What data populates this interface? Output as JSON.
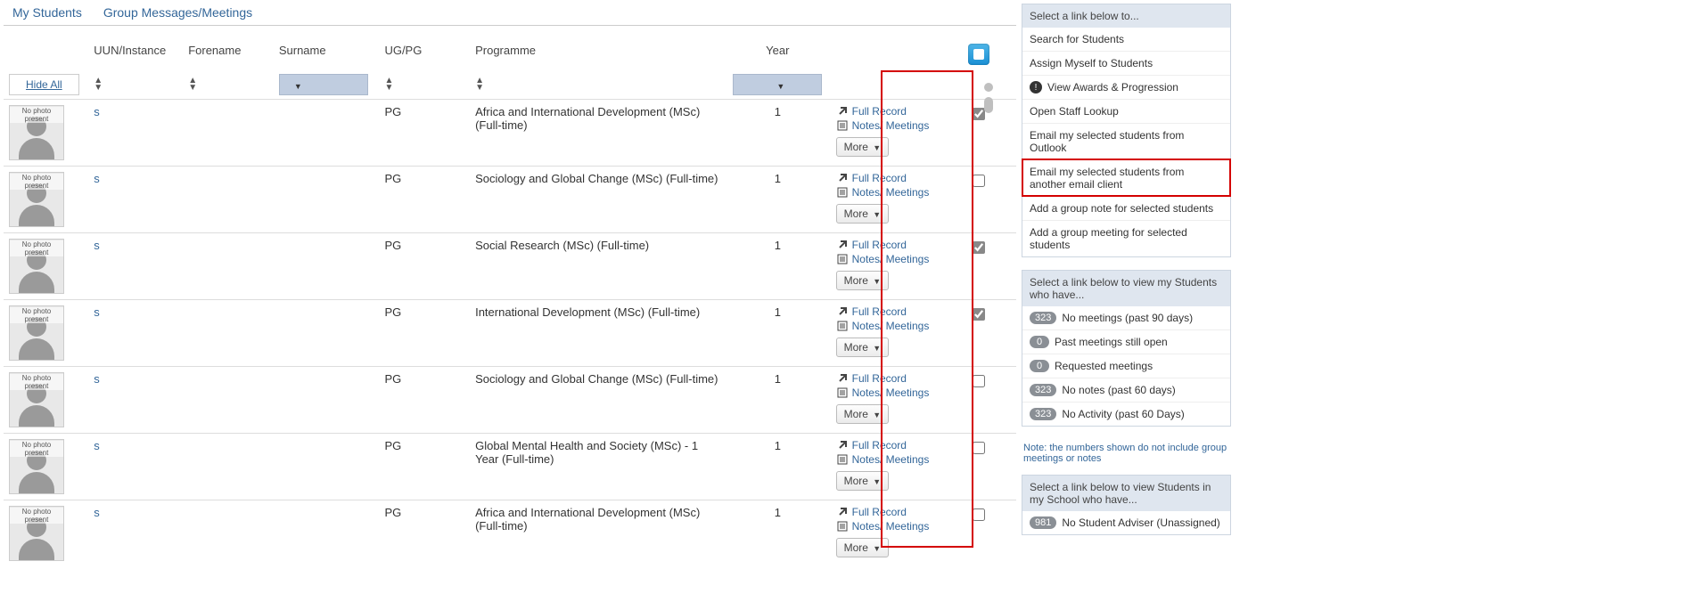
{
  "tabs": {
    "my_students": "My Students",
    "group_messages": "Group Messages/Meetings"
  },
  "columns": {
    "uun": "UUN/Instance",
    "forename": "Forename",
    "surname": "Surname",
    "ugpg": "UG/PG",
    "programme": "Programme",
    "year": "Year"
  },
  "hide_all": "Hide All",
  "photo_label": "No photo present",
  "action_labels": {
    "full_record": "Full Record",
    "notes_meetings": "Notes/ Meetings",
    "more": "More"
  },
  "rows": [
    {
      "uun": "s",
      "ugpg": "PG",
      "programme": "Africa and International Development (MSc) (Full-time)",
      "year": "1",
      "checked": true
    },
    {
      "uun": "s",
      "ugpg": "PG",
      "programme": "Sociology and Global Change (MSc) (Full-time)",
      "year": "1",
      "checked": false
    },
    {
      "uun": "s",
      "ugpg": "PG",
      "programme": "Social Research (MSc) (Full-time)",
      "year": "1",
      "checked": true
    },
    {
      "uun": "s",
      "ugpg": "PG",
      "programme": "International Development (MSc) (Full-time)",
      "year": "1",
      "checked": true
    },
    {
      "uun": "s",
      "ugpg": "PG",
      "programme": "Sociology and Global Change (MSc) (Full-time)",
      "year": "1",
      "checked": false
    },
    {
      "uun": "s",
      "ugpg": "PG",
      "programme": "Global Mental Health and Society (MSc) - 1 Year (Full-time)",
      "year": "1",
      "checked": false
    },
    {
      "uun": "s",
      "ugpg": "PG",
      "programme": "Africa and International Development (MSc) (Full-time)",
      "year": "1",
      "checked": false
    }
  ],
  "links_panel": {
    "header": "Select a link below to...",
    "items": [
      {
        "label": "Search for Students",
        "icon": ""
      },
      {
        "label": "Assign Myself to Students",
        "icon": ""
      },
      {
        "label": "View Awards & Progression",
        "icon": "!"
      },
      {
        "label": "Open Staff Lookup",
        "icon": ""
      },
      {
        "label": "Email my selected students from Outlook",
        "icon": ""
      },
      {
        "label": "Email my selected students from another email client",
        "icon": "",
        "highlighted": true
      },
      {
        "label": "Add a group note for selected students",
        "icon": ""
      },
      {
        "label": "Add a group meeting for selected students",
        "icon": ""
      }
    ]
  },
  "students_panel": {
    "header": "Select a link below to view my Students who have...",
    "items": [
      {
        "badge": "323",
        "label": "No meetings (past 90 days)"
      },
      {
        "badge": "0",
        "label": "Past meetings still open"
      },
      {
        "badge": "0",
        "label": "Requested meetings"
      },
      {
        "badge": "323",
        "label": "No notes (past 60 days)"
      },
      {
        "badge": "323",
        "label": "No Activity (past 60 Days)"
      }
    ],
    "note": "Note: the numbers shown do not include group meetings or notes"
  },
  "school_panel": {
    "header": "Select a link below to view Students in my School who have...",
    "items": [
      {
        "badge": "981",
        "label": "No Student Adviser (Unassigned)"
      }
    ]
  }
}
